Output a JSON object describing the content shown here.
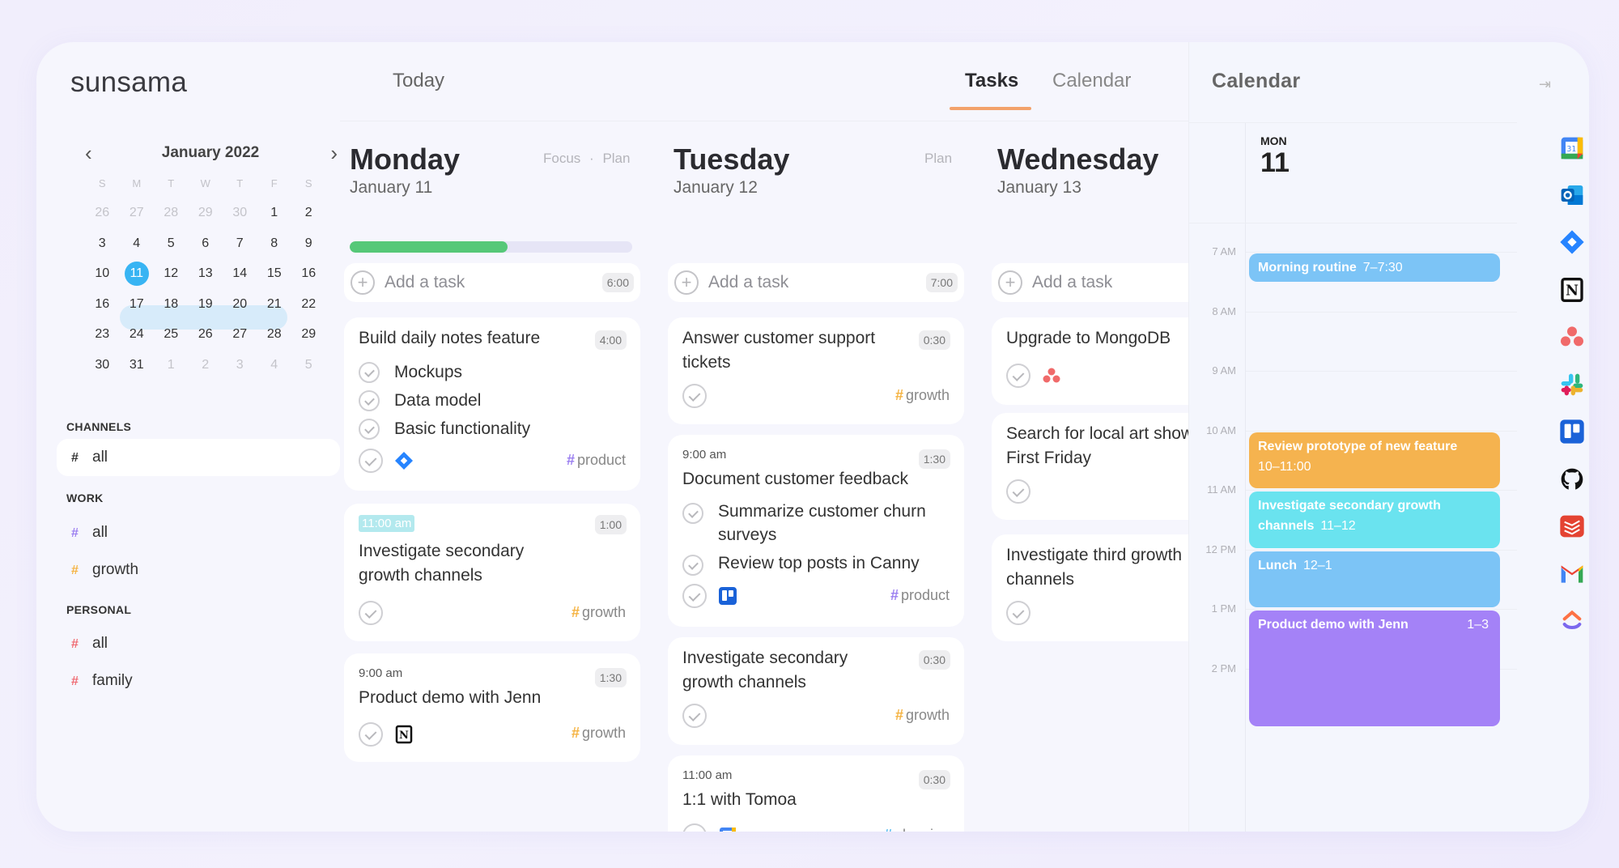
{
  "app": {
    "logo": "sunsama"
  },
  "header": {
    "title": "Today",
    "tabs": [
      {
        "label": "Tasks",
        "active": true
      },
      {
        "label": "Calendar",
        "active": false
      }
    ]
  },
  "mini_calendar": {
    "month_label": "January 2022",
    "prev_icon": "chevron-left-icon",
    "next_icon": "chevron-right-icon",
    "weekdays": [
      "S",
      "M",
      "T",
      "W",
      "T",
      "F",
      "S"
    ],
    "weeks": [
      [
        "26",
        "27",
        "28",
        "29",
        "30",
        "1",
        "2"
      ],
      [
        "3",
        "4",
        "5",
        "6",
        "7",
        "8",
        "9"
      ],
      [
        "10",
        "11",
        "12",
        "13",
        "14",
        "15",
        "16"
      ],
      [
        "16",
        "17",
        "18",
        "19",
        "20",
        "21",
        "22"
      ],
      [
        "23",
        "24",
        "25",
        "26",
        "27",
        "28",
        "29"
      ],
      [
        "30",
        "31",
        "1",
        "2",
        "3",
        "4",
        "5"
      ]
    ],
    "selected": "11",
    "highlighted_week": [
      "11",
      "12",
      "13",
      "14",
      "15"
    ]
  },
  "sidebar": {
    "channels_label": "CHANNELS",
    "channels": [
      {
        "hash": "#",
        "label": "all",
        "color": "#333333",
        "active": true
      }
    ],
    "work_label": "WORK",
    "work": [
      {
        "hash": "#",
        "label": "all",
        "color": "#9b7ff0"
      },
      {
        "hash": "#",
        "label": "growth",
        "color": "#f5b342"
      }
    ],
    "personal_label": "PERSONAL",
    "personal": [
      {
        "hash": "#",
        "label": "all",
        "color": "#ef6b73"
      },
      {
        "hash": "#",
        "label": "family",
        "color": "#ef6b73"
      }
    ]
  },
  "days": [
    {
      "name": "Monday",
      "date": "January 11",
      "links": [
        "Focus",
        "·",
        "Plan"
      ],
      "progress_percent": 56,
      "add_task": {
        "label": "Add a task",
        "total": "6:00"
      },
      "tasks": [
        {
          "title": "Build daily notes feature",
          "duration": "4:00",
          "subtasks": [
            "Mockups",
            "Data model",
            "Basic functionality"
          ],
          "integration": "jira-icon",
          "channel": "product",
          "channel_color": "#9b7ff0"
        },
        {
          "time": "11:00 am",
          "title": "Investigate secondary growth channels",
          "duration": "1:00",
          "channel": "growth",
          "channel_color": "#f5b342"
        },
        {
          "time": "9:00 am",
          "title": "Product demo with Jenn",
          "duration": "1:30",
          "integration": "notion-icon",
          "channel": "growth",
          "channel_color": "#f5b342"
        }
      ]
    },
    {
      "name": "Tuesday",
      "date": "January 12",
      "links": [
        "Plan"
      ],
      "add_task": {
        "label": "Add a task",
        "total": "7:00"
      },
      "tasks": [
        {
          "title": "Answer customer support tickets",
          "duration": "0:30",
          "channel": "growth",
          "channel_color": "#f5b342"
        },
        {
          "time": "9:00 am",
          "title": "Document customer feedback",
          "duration": "1:30",
          "subtasks": [
            "Summarize customer churn surveys",
            "Review top posts in Canny"
          ],
          "integration": "trello-icon",
          "channel": "product",
          "channel_color": "#9b7ff0"
        },
        {
          "title": "Investigate secondary growth channels",
          "duration": "0:30",
          "channel": "growth",
          "channel_color": "#f5b342"
        },
        {
          "time": "11:00 am",
          "title": "1:1 with Tomoa",
          "duration": "0:30",
          "integration": "google-calendar-icon",
          "channel": "planning",
          "channel_color": "#4fb8f0"
        }
      ]
    },
    {
      "name": "Wednesday",
      "date": "January 13",
      "add_task": {
        "label": "Add a task"
      },
      "tasks": [
        {
          "title": "Upgrade to MongoDB",
          "integration": "asana-icon"
        },
        {
          "title": "Search for local art shows on First Friday"
        },
        {
          "title": "Investigate third growth channels"
        }
      ]
    }
  ],
  "calendar_panel": {
    "title": "Calendar",
    "collapse_icon": "collapse-right-icon",
    "day_of_week": "MON",
    "day_number": "11",
    "hours": [
      "7 AM",
      "8 AM",
      "9 AM",
      "10 AM",
      "11 AM",
      "12 PM",
      "1 PM",
      "2 PM"
    ],
    "events": [
      {
        "title": "Morning routine",
        "time": "7–7:30",
        "start": 7.0,
        "end": 7.5,
        "color": "#7cc4f6"
      },
      {
        "title": "Review prototype of new feature",
        "time": "10–11:00",
        "start": 10.0,
        "end": 11.0,
        "color": "#f5b34f"
      },
      {
        "title": "Investigate secondary growth channels",
        "time": "11–12",
        "start": 11.0,
        "end": 12.0,
        "color": "#6ae3ef"
      },
      {
        "title": "Lunch",
        "time": "12–1",
        "start": 12.0,
        "end": 13.0,
        "color": "#7cc4f6"
      },
      {
        "title": "Product demo with Jenn",
        "time": "1–3",
        "start": 13.0,
        "end": 15.0,
        "color": "#a482f7"
      }
    ]
  },
  "integrations": [
    "google-calendar-icon",
    "outlook-icon",
    "jira-icon",
    "notion-icon",
    "asana-icon",
    "slack-icon",
    "trello-icon",
    "github-icon",
    "todoist-icon",
    "gmail-icon",
    "clickup-icon"
  ],
  "colors": {
    "accent_tab": "#f3a26b",
    "progress": "#56c878",
    "selected_day": "#38b4f3"
  }
}
